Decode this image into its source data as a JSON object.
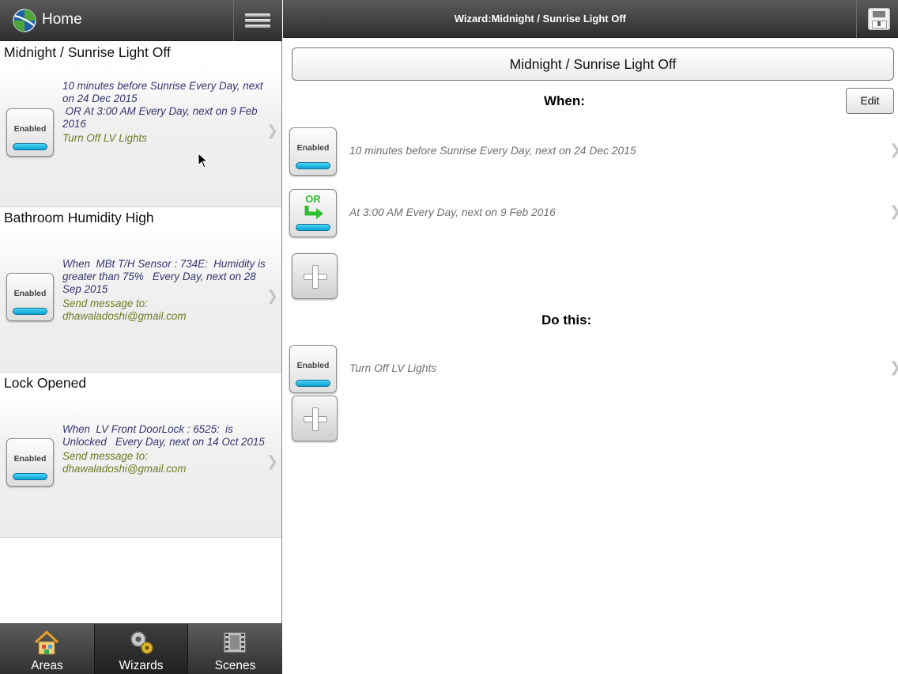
{
  "sidebar": {
    "home_label": "Home",
    "wizards": [
      {
        "title": "Midnight / Sunrise Light Off",
        "badge": "Enabled",
        "condition": "10 minutes before Sunrise Every Day, next on 24 Dec 2015\n OR At 3:00 AM Every Day, next on 9 Feb 2016",
        "action": "Turn Off LV Lights"
      },
      {
        "title": "Bathroom Humidity High",
        "badge": "Enabled",
        "condition": "When  MBt T/H Sensor : 734E:  Humidity is greater than 75%   Every Day, next on 28 Sep 2015",
        "action": "Send message to: dhawaladoshi@gmail.com"
      },
      {
        "title": "Lock Opened",
        "badge": "Enabled",
        "condition": "When  LV Front DoorLock : 6525:  is Unlocked   Every Day, next on 14 Oct 2015",
        "action": "Send message to: dhawaladoshi@gmail.com"
      }
    ]
  },
  "tabs": [
    {
      "label": "Areas",
      "icon": "house-icon"
    },
    {
      "label": "Wizards",
      "icon": "gears-icon",
      "active": true
    },
    {
      "label": "Scenes",
      "icon": "film-icon"
    }
  ],
  "detail": {
    "header_title": "Wizard:Midnight / Sunrise Light Off",
    "name": "Midnight / Sunrise Light Off",
    "when_label": "When:",
    "edit_label": "Edit",
    "conditions": [
      {
        "badge": "Enabled",
        "text": "10 minutes before Sunrise Every Day, next on 24 Dec 2015"
      },
      {
        "badge": "OR",
        "text": "At 3:00 AM Every Day, next on 9 Feb 2016"
      }
    ],
    "do_label": "Do this:",
    "actions": [
      {
        "badge": "Enabled",
        "text": "Turn Off LV Lights"
      }
    ]
  },
  "colors": {
    "header": "#3f3f3f",
    "condition_text": "#35356e",
    "action_text": "#6d7b25",
    "enabled_bar": "#1ab4e0",
    "or_green": "#2fbf2f"
  }
}
